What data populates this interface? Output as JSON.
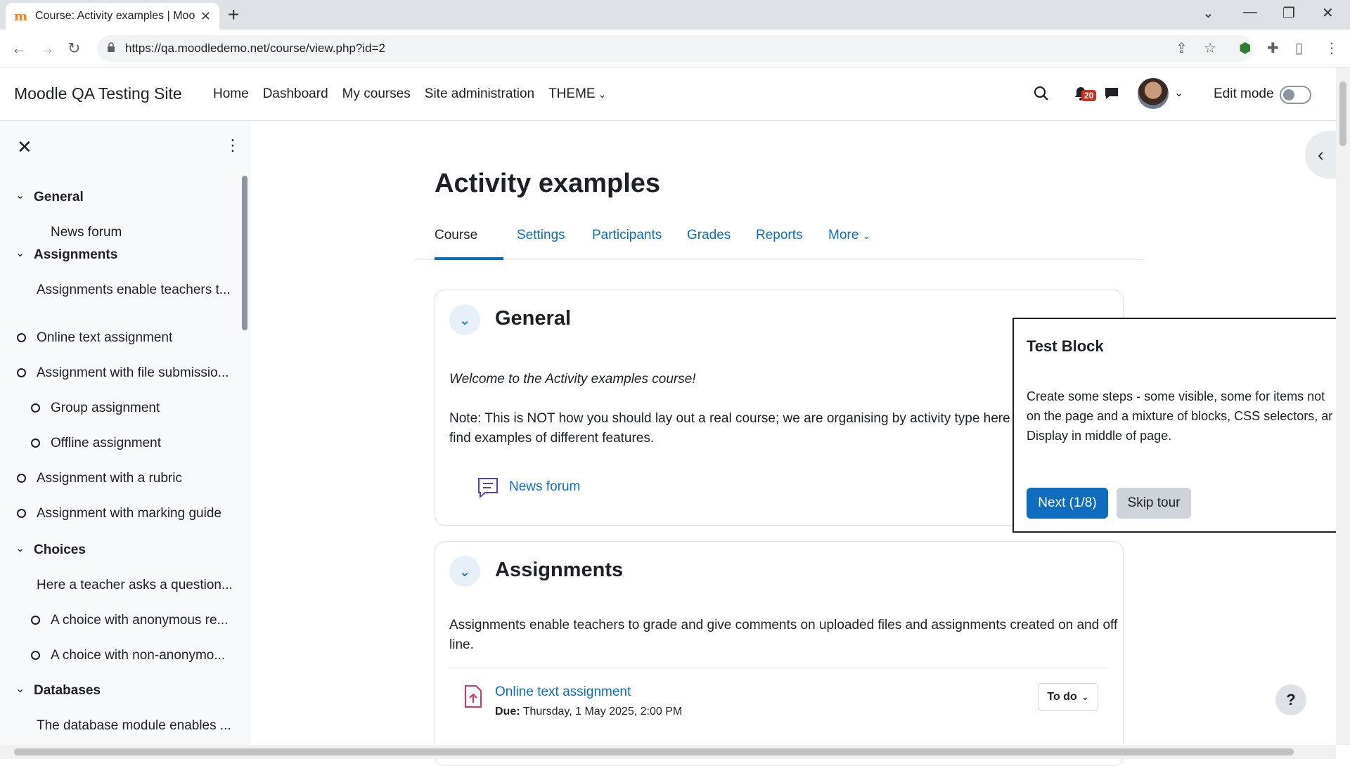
{
  "browser": {
    "tab_title": "Course: Activity examples | Moodle",
    "url": "https://qa.moodledemo.net/course/view.php?id=2"
  },
  "navbar": {
    "site_name": "Moodle QA Testing Site",
    "items": [
      "Home",
      "Dashboard",
      "My courses",
      "Site administration",
      "THEME"
    ],
    "notification_count": "20",
    "edit_mode_label": "Edit mode"
  },
  "drawer": {
    "items": [
      {
        "label": "General",
        "type": "section"
      },
      {
        "label": "News forum",
        "type": "activity"
      },
      {
        "label": "Assignments",
        "type": "section"
      },
      {
        "label": "Assignments enable teachers t...",
        "type": "label"
      },
      {
        "label": "Online text assignment",
        "type": "activity"
      },
      {
        "label": "Assignment with file submissio...",
        "type": "activity"
      },
      {
        "label": "Group assignment",
        "type": "activity"
      },
      {
        "label": "Offline assignment",
        "type": "activity"
      },
      {
        "label": "Assignment with a rubric",
        "type": "activity"
      },
      {
        "label": "Assignment with marking guide",
        "type": "activity"
      },
      {
        "label": "Choices",
        "type": "section"
      },
      {
        "label": "Here a teacher asks a question...",
        "type": "label"
      },
      {
        "label": "A choice with anonymous re...",
        "type": "activity"
      },
      {
        "label": "A choice with non-anonymo...",
        "type": "activity"
      },
      {
        "label": "Databases",
        "type": "section"
      },
      {
        "label": "The database module enables ...",
        "type": "label"
      }
    ]
  },
  "page": {
    "title": "Activity examples",
    "tabs": [
      "Course",
      "Settings",
      "Participants",
      "Grades",
      "Reports",
      "More"
    ]
  },
  "general": {
    "title": "General",
    "welcome": "Welcome to the Activity examples course!",
    "note_line1": "Note: This is NOT how you should lay out a real course; we are organising by activity type here ju",
    "note_line2": "find examples of different features.",
    "forum_link": "News forum"
  },
  "assignments": {
    "title": "Assignments",
    "desc_line1": "Assignments enable teachers to grade and give comments on uploaded files and assignments created on and off",
    "desc_line2": "line.",
    "activity_link": "Online text assignment",
    "due_label": "Due:",
    "due_value": "Thursday, 1 May 2025, 2:00 PM",
    "todo_label": "To do"
  },
  "tour": {
    "title": "Test Block",
    "line1": "Create some steps - some visible, some for items not",
    "line2": "on the page and a mixture of blocks, CSS selectors, ar",
    "line3": "Display in middle of page.",
    "next_label": "Next (1/8)",
    "skip_label": "Skip tour"
  },
  "help_label": "?"
}
